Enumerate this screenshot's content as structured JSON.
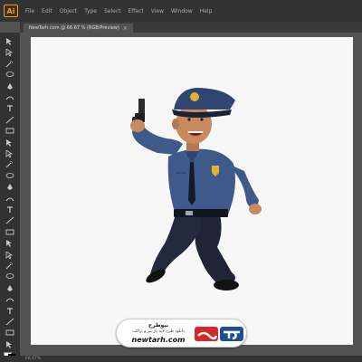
{
  "app": {
    "logo_text": "Ai"
  },
  "menu": [
    "File",
    "Edit",
    "Object",
    "Type",
    "Select",
    "Effect",
    "View",
    "Window",
    "Help"
  ],
  "document": {
    "tab_title": "NewTarh.com @ 66.67 % (RGB/Preview)",
    "close_glyph": "×"
  },
  "tools": [
    "selection-tool",
    "direct-selection-tool",
    "magic-wand-tool",
    "lasso-tool",
    "pen-tool",
    "curvature-tool",
    "type-tool",
    "line-tool",
    "rectangle-tool",
    "paintbrush-tool",
    "pencil-tool",
    "eraser-tool",
    "rotate-tool",
    "scale-tool",
    "width-tool",
    "free-transform-tool",
    "shape-builder-tool",
    "perspective-grid-tool",
    "mesh-tool",
    "gradient-tool",
    "eyedropper-tool",
    "blend-tool",
    "symbol-sprayer-tool",
    "column-graph-tool",
    "artboard-tool",
    "slice-tool",
    "hand-tool",
    "zoom-tool"
  ],
  "status": {
    "zoom": "66.67%"
  },
  "watermark": {
    "brand_fa": "نیوطرح",
    "tagline_fa": "دانلود طرح لایه باز بنر و تراکت",
    "url": "newtarh.com",
    "logo_text_fa": "نیوطرح"
  },
  "colors": {
    "uniform": "#3d5a8a",
    "uniform_dark": "#2e4670",
    "trousers": "#1f2436",
    "skin": "#c98a5e",
    "badge_gold": "#e0b23a",
    "logo_red": "#d62828",
    "logo_blue": "#1d4f91"
  }
}
